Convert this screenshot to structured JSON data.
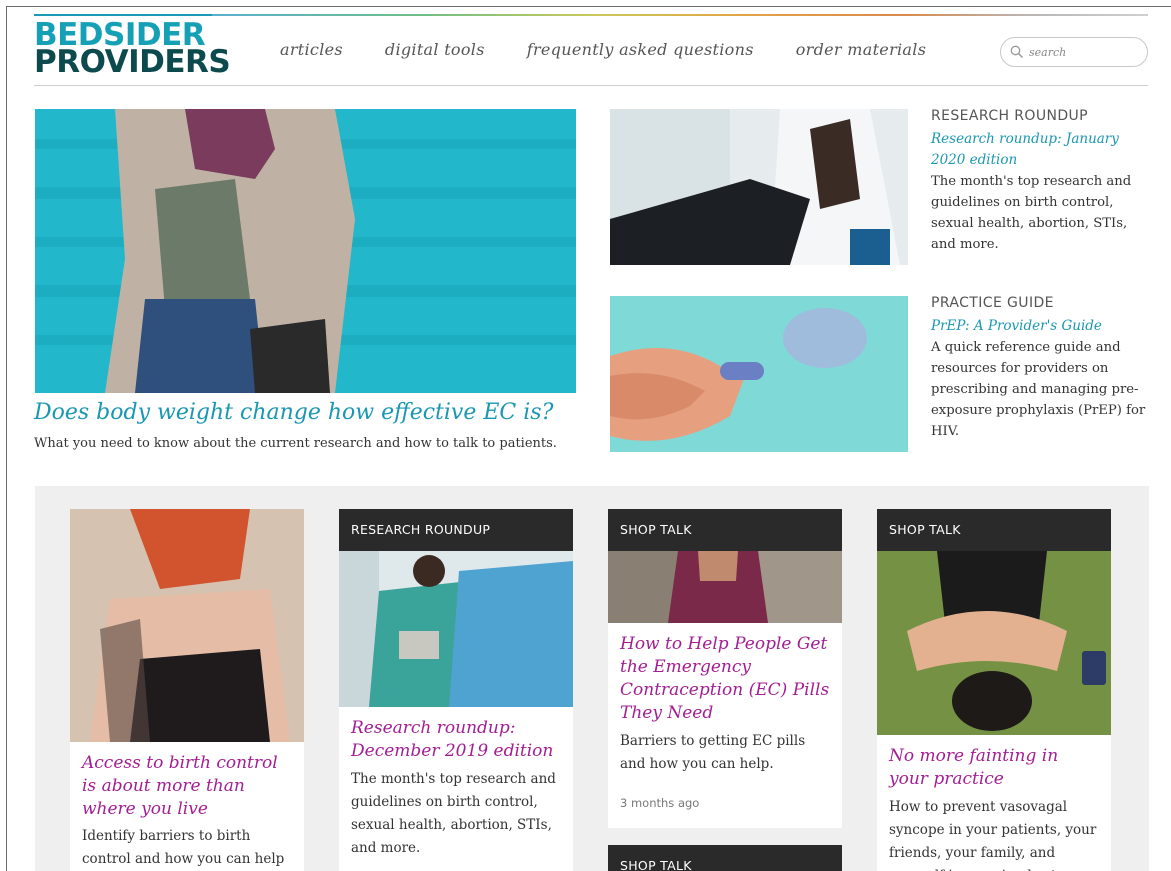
{
  "header": {
    "logo_line1": "BEDSIDER",
    "logo_line2": "PROVIDERS",
    "nav": [
      "articles",
      "digital tools",
      "frequently asked questions",
      "order materials"
    ],
    "search_placeholder": "search"
  },
  "hero": {
    "title": "Does body weight change how effective EC is?",
    "description": "What you need to know about the current research and how to talk to patients."
  },
  "features": [
    {
      "kicker": "RESEARCH ROUNDUP",
      "title": "Research roundup: January 2020 edition",
      "description": "The month's top research and guidelines on birth control, sexual health, abortion, STIs, and more."
    },
    {
      "kicker": "PRACTICE GUIDE",
      "title": "PrEP: A Provider's Guide",
      "description": "A quick reference guide and resources for providers on prescribing and managing pre-exposure prophylaxis (PrEP) for HIV."
    }
  ],
  "cards": [
    {
      "title": "Access to birth control is about more than where you live",
      "description": "Identify barriers to birth control and how you can help"
    },
    {
      "category": "RESEARCH ROUNDUP",
      "title": "Research roundup: December 2019 edition",
      "description": "The month's top research and guidelines on birth control, sexual health, abortion, STIs, and more."
    },
    {
      "category": "SHOP TALK",
      "title": "How to Help People Get the Emergency Contraception (EC) Pills They Need",
      "description": "Barriers to getting EC pills and how you can help.",
      "meta": "3 months ago"
    },
    {
      "category": "SHOP TALK",
      "title": "No more fainting in your practice",
      "description": "How to prevent vasovagal syncope in your patients, your friends, your family, and yourself in one simple step."
    },
    {
      "category": "SHOP TALK"
    }
  ],
  "colors": {
    "brand_teal": "#1a97b2",
    "brand_dark": "#0d4a4e",
    "card_title_magenta": "#a31e93",
    "category_bar": "#2a2a2a",
    "section_gray": "#efefef"
  }
}
